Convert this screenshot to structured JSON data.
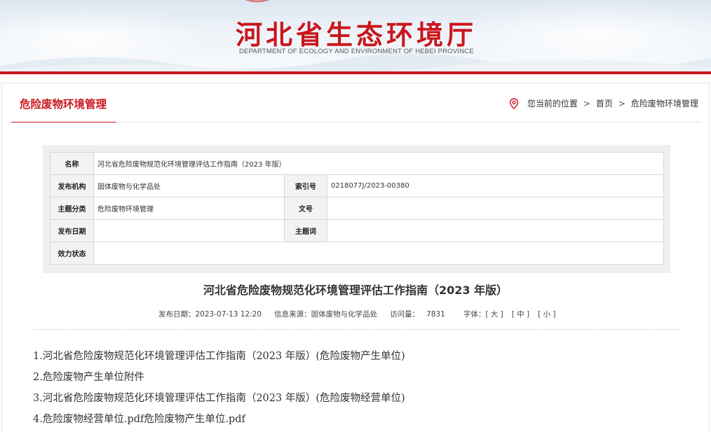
{
  "header": {
    "site_title": "河北省生态环境厅",
    "site_subtitle": "DEPARTMENT OF ECOLOGY AND ENVIRONMENT OF HEBEI PROVINCE"
  },
  "section": {
    "title": "危险废物环境管理"
  },
  "breadcrumb": {
    "location_label": "您当前的位置",
    "separator": ">",
    "home": "首页",
    "current": "危险废物环境管理"
  },
  "info": {
    "name_label": "名称",
    "name_value": "河北省危险废物规范化环境管理评估工作指南（2023 年版）",
    "publisher_label": "发布机构",
    "publisher_value": "固体废物与化学品处",
    "index_label": "索引号",
    "index_value": "0218077J/2023-00380",
    "topic_label": "主题分类",
    "topic_value": "危险废物环境管理",
    "docno_label": "文号",
    "docno_value": "",
    "date_label": "发布日期",
    "date_value": "",
    "keyword_label": "主题词",
    "keyword_value": "",
    "status_label": "效力状态",
    "status_value": ""
  },
  "article": {
    "title": "河北省危险废物规范化环境管理评估工作指南（2023 年版）",
    "publish_date": "发布日期：2023-07-13 12:20",
    "source": "信息来源：固体废物与化学品处",
    "views_label": "访问量：",
    "views": "7831",
    "font_label": "字体：",
    "font_large": "[ 大 ]",
    "font_medium": "[ 中 ]",
    "font_small": "[ 小 ]"
  },
  "attachments": [
    "1.河北省危险废物规范化环境管理评估工作指南（2023 年版）(危险废物产生单位)",
    "2.危险废物产生单位附件",
    "3.河北省危险废物规范化环境管理评估工作指南（2023 年版）(危险废物经营单位)",
    "4.危险废物经营单位.pdf危险废物产生单位.pdf"
  ],
  "colors": {
    "brand_red": "#c8161d"
  },
  "icons": {
    "location": "map-pin-icon"
  }
}
